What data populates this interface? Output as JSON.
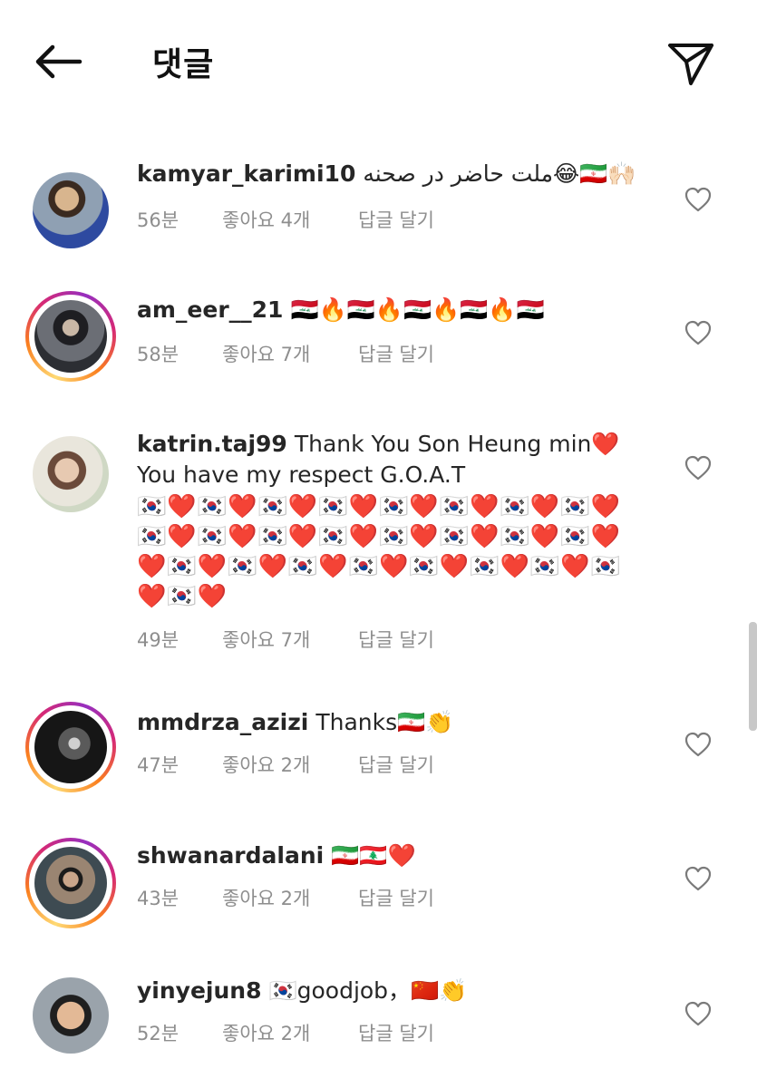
{
  "header": {
    "title": "댓글",
    "back_icon": "arrow-left-icon",
    "send_icon": "paper-plane-icon"
  },
  "comments": [
    {
      "username": "kamyar_karimi10",
      "text": "ملت حاضر در صحنه😂🇮🇷🙌🏻",
      "time": "56분",
      "likes": "좋아요 4개",
      "reply": "답글 달기",
      "story_ring": false
    },
    {
      "username": "am_eer__21",
      "text": "🇮🇶🔥🇮🇶🔥🇮🇶🔥🇮🇶🔥🇮🇶",
      "time": "58분",
      "likes": "좋아요 7개",
      "reply": "답글 달기",
      "story_ring": true
    },
    {
      "username": "katrin.taj99",
      "text": "Thank You Son Heung min❤️ You have my respect G.O.A.T",
      "emoji_line": "🇰🇷❤️🇰🇷❤️🇰🇷❤️🇰🇷❤️🇰🇷❤️🇰🇷❤️🇰🇷❤️🇰🇷❤️🇰🇷❤️🇰🇷❤️🇰🇷❤️🇰🇷❤️🇰🇷❤️🇰🇷❤️🇰🇷❤️🇰🇷❤️❤️🇰🇷❤️🇰🇷❤️🇰🇷❤️🇰🇷❤️🇰🇷❤️🇰🇷❤️🇰🇷❤️🇰🇷❤️🇰🇷❤️",
      "time": "49분",
      "likes": "좋아요 7개",
      "reply": "답글 달기",
      "story_ring": false
    },
    {
      "username": "mmdrza_azizi",
      "text": "Thanks🇮🇷👏",
      "time": "47분",
      "likes": "좋아요 2개",
      "reply": "답글 달기",
      "story_ring": true
    },
    {
      "username": "shwanardalani",
      "text": "🇮🇷🇱🇧❤️",
      "time": "43분",
      "likes": "좋아요 2개",
      "reply": "답글 달기",
      "story_ring": true
    },
    {
      "username": "yinyejun8",
      "text": "🇰🇷goodjob，🇨🇳👏",
      "time": "52분",
      "likes": "좋아요 2개",
      "reply": "답글 달기",
      "story_ring": false
    }
  ],
  "icons": {
    "like": "heart-outline-icon"
  }
}
